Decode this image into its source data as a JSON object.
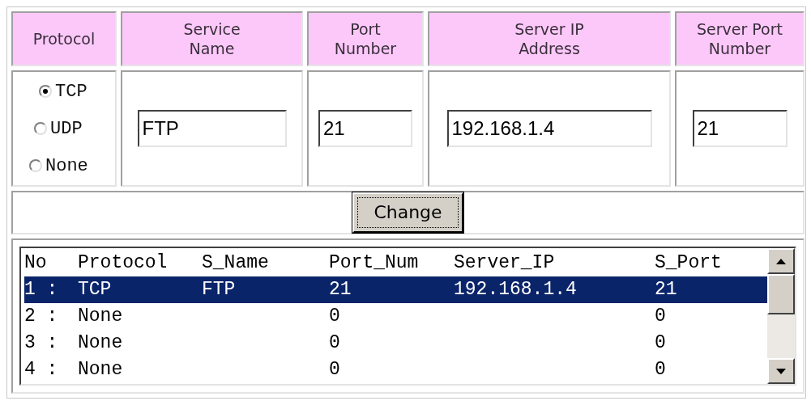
{
  "form": {
    "headers": [
      "Protocol",
      "Service\nName",
      "Port\nNumber",
      "Server IP\nAddress",
      "Server Port\nNumber"
    ],
    "protocol_options": [
      {
        "label": "TCP",
        "selected": true
      },
      {
        "label": "UDP",
        "selected": false
      },
      {
        "label": "None",
        "selected": false
      }
    ],
    "service_name": "FTP",
    "port_number": "21",
    "server_ip": "192.168.1.4",
    "server_port": "21"
  },
  "change_button": "Change",
  "list": {
    "columns": [
      "No",
      "Protocol",
      "S_Name",
      "Port_Num",
      "Server_IP",
      "S_Port"
    ],
    "rows": [
      {
        "selected": true,
        "cells": [
          "1 :",
          "TCP",
          "FTP",
          "21",
          "192.168.1.4",
          "21"
        ]
      },
      {
        "selected": false,
        "cells": [
          "2 :",
          "None",
          null,
          "0",
          null,
          "0"
        ]
      },
      {
        "selected": false,
        "cells": [
          "3 :",
          "None",
          null,
          "0",
          null,
          "0"
        ]
      },
      {
        "selected": false,
        "cells": [
          "4 :",
          "None",
          null,
          "0",
          null,
          "0"
        ]
      }
    ]
  }
}
